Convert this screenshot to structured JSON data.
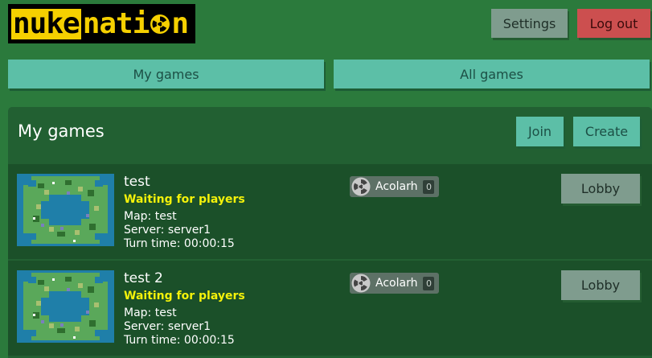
{
  "app": {
    "logo_part1": "nuke",
    "logo_part2": "nati",
    "logo_part3": "n"
  },
  "header": {
    "settings_label": "Settings",
    "logout_label": "Log out"
  },
  "tabs": [
    {
      "label": "My games"
    },
    {
      "label": "All games"
    }
  ],
  "panel": {
    "title": "My games",
    "join_label": "Join",
    "create_label": "Create"
  },
  "games": [
    {
      "name": "test",
      "status": "Waiting for players",
      "map": "Map: test",
      "server": "Server: server1",
      "turn_time": "Turn time: 00:00:15",
      "player_name": "Acolarh",
      "player_count": "0",
      "lobby_label": "Lobby"
    },
    {
      "name": "test 2",
      "status": "Waiting for players",
      "map": "Map: test",
      "server": "Server: server1",
      "turn_time": "Turn time: 00:00:15",
      "player_name": "Acolarh",
      "player_count": "0",
      "lobby_label": "Lobby"
    }
  ],
  "colors": {
    "background": "#2b7a3c",
    "panel": "#226032",
    "row": "#1b5029",
    "teal_button": "#5cbfa7",
    "status_yellow": "#f4f20a",
    "logout_red": "#cc4f4f"
  },
  "icons": {
    "logo_symbol": "radiation-icon",
    "player_avatar": "radiation-icon"
  }
}
